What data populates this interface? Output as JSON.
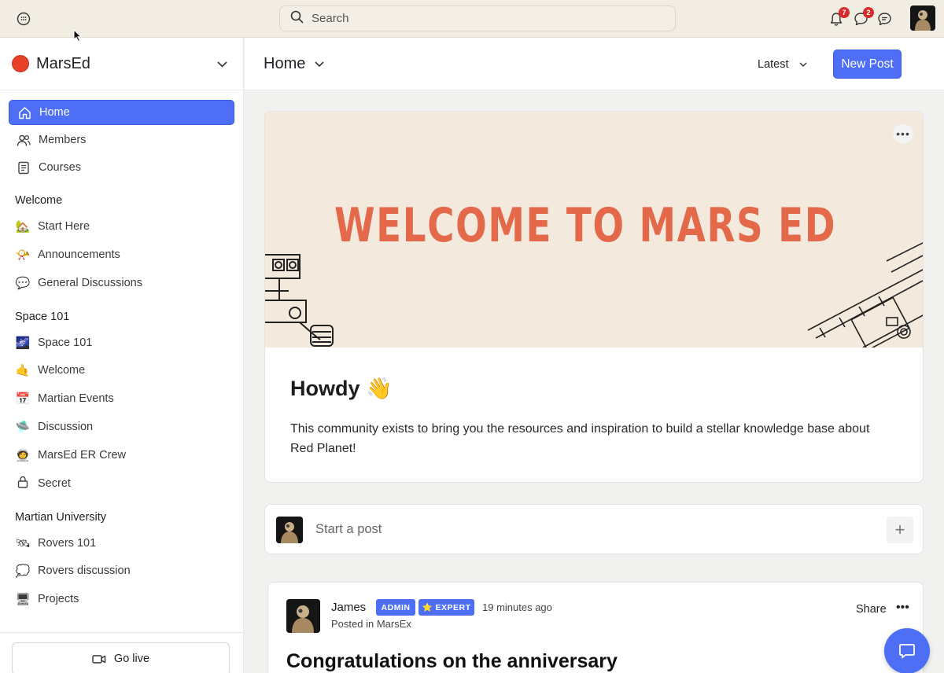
{
  "topbar": {
    "search_placeholder": "Search",
    "notifications_count": "7",
    "messages_count": "2"
  },
  "sidebar": {
    "community_name": "MarsEd",
    "nav": [
      {
        "label": "Home",
        "icon": "home-icon",
        "active": true
      },
      {
        "label": "Members",
        "icon": "members-icon"
      },
      {
        "label": "Courses",
        "icon": "courses-icon"
      }
    ],
    "groups": [
      {
        "title": "Welcome",
        "items": [
          {
            "label": "Start Here",
            "emoji": "🏡"
          },
          {
            "label": "Announcements",
            "emoji": "📯"
          },
          {
            "label": "General Discussions",
            "emoji": "💬"
          }
        ]
      },
      {
        "title": "Space 101",
        "items": [
          {
            "label": "Space 101",
            "emoji": "🌌"
          },
          {
            "label": "Welcome",
            "emoji": "🤙"
          },
          {
            "label": "Martian Events",
            "emoji": "📅"
          },
          {
            "label": "Discussion",
            "emoji": "🛸"
          },
          {
            "label": "MarsEd ER Crew",
            "emoji": "🧑‍🚀"
          },
          {
            "label": "Secret",
            "emoji": "🔒"
          }
        ]
      },
      {
        "title": "Martian University",
        "items": [
          {
            "label": "Rovers 101",
            "emoji": "🛰"
          },
          {
            "label": "Rovers discussion",
            "emoji": "💭"
          },
          {
            "label": "Projects",
            "emoji": "🖥"
          }
        ]
      }
    ],
    "go_live_label": "Go live"
  },
  "header": {
    "title": "Home",
    "sort_label": "Latest",
    "new_post_label": "New Post"
  },
  "welcome_card": {
    "banner_text": "WELCOME TO MARS ED",
    "heading": "Howdy 👋",
    "body": "This community exists to bring you the resources and inspiration to build a stellar knowledge base about Red Planet!"
  },
  "composer": {
    "placeholder": "Start a post"
  },
  "post": {
    "author": "James",
    "badge_admin": "ADMIN",
    "badge_expert": "⭐ EXPERT",
    "time": "19 minutes ago",
    "posted_in": "Posted in MarsEx",
    "share_label": "Share",
    "title": "Congratulations on the anniversary"
  },
  "colors": {
    "accent": "#4d6ef5",
    "brand_dot": "#e8412a",
    "banner_bg": "#f3e9dc",
    "banner_text": "#e3694a",
    "badge_red": "#d92b2b"
  }
}
